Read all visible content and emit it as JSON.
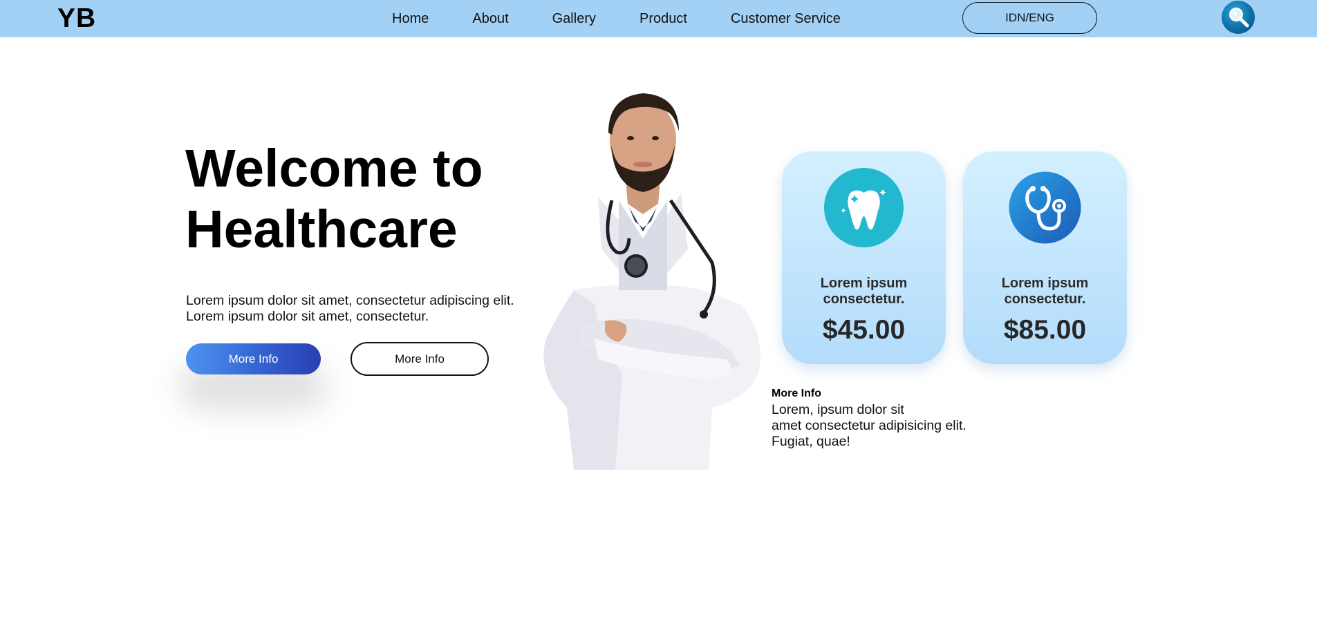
{
  "header": {
    "logo": "YB",
    "nav": [
      "Home",
      "About",
      "Gallery",
      "Product",
      "Customer Service"
    ],
    "language_button": "IDN/ENG",
    "search_icon": "search-icon"
  },
  "hero": {
    "title": "Welcome to Healthcare",
    "description": [
      "Lorem ipsum dolor sit amet, consectetur adipiscing elit.",
      "Lorem ipsum dolor sit amet, consectetur."
    ],
    "primary_button": "More Info",
    "secondary_button": "More Info",
    "image": "doctor-image"
  },
  "cards": [
    {
      "icon": "tooth-icon",
      "title_lines": [
        "Lorem ipsum",
        "consectetur."
      ],
      "price": "$45.00"
    },
    {
      "icon": "stethoscope-icon",
      "title_lines": [
        "Lorem ipsum",
        "consectetur."
      ],
      "price": "$85.00"
    }
  ],
  "more_info": {
    "title": "More Info",
    "text": [
      "Lorem, ipsum dolor sit",
      "amet consectetur adipisicing elit.",
      "Fugiat, quae!"
    ]
  },
  "colors": {
    "nav_background": "#a3d1f5",
    "card_background": "#c4e6fd",
    "primary_gradient_start": "#4d93ee",
    "primary_gradient_end": "#2a3fb2",
    "tooth_icon_bg": "#22b8cf",
    "stethoscope_icon_bg": "#1f7fd0"
  }
}
